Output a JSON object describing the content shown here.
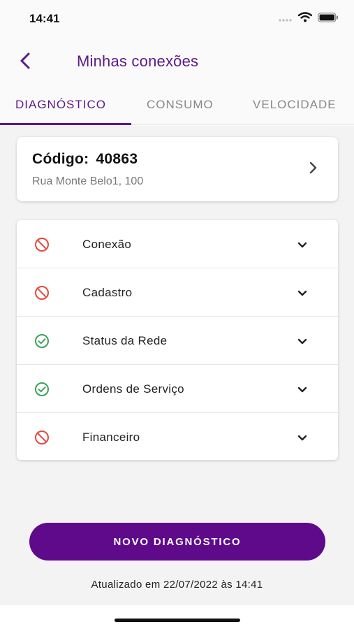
{
  "status_bar": {
    "time": "14:41",
    "icons": [
      "cellular-signal-icon",
      "wifi-icon",
      "battery-icon"
    ]
  },
  "header": {
    "title": "Minhas conexões",
    "back_icon": "chevron-left-icon"
  },
  "tabs": [
    {
      "label": "DIAGNÓSTICO",
      "active": true
    },
    {
      "label": "CONSUMO",
      "active": false
    },
    {
      "label": "VELOCIDADE",
      "active": false
    }
  ],
  "connection_card": {
    "code_label": "Código:",
    "code_value": "40863",
    "address": "Rua Monte Belo1, 100"
  },
  "diagnostics": [
    {
      "label": "Conexão",
      "status": "error",
      "icon": "prohibited-icon"
    },
    {
      "label": "Cadastro",
      "status": "error",
      "icon": "prohibited-icon"
    },
    {
      "label": "Status da Rede",
      "status": "ok",
      "icon": "check-circle-icon"
    },
    {
      "label": "Ordens de Serviço",
      "status": "ok",
      "icon": "check-circle-icon"
    },
    {
      "label": "Financeiro",
      "status": "error",
      "icon": "prohibited-icon"
    }
  ],
  "actions": {
    "new_diagnostic_label": "NOVO DIAGNÓSTICO"
  },
  "updated_text": "Atualizado em 22/07/2022 às 14:41",
  "colors": {
    "brand": "#5e0a8a",
    "title": "#5a1a8a",
    "error": "#e5493f",
    "ok": "#3aa35a"
  }
}
